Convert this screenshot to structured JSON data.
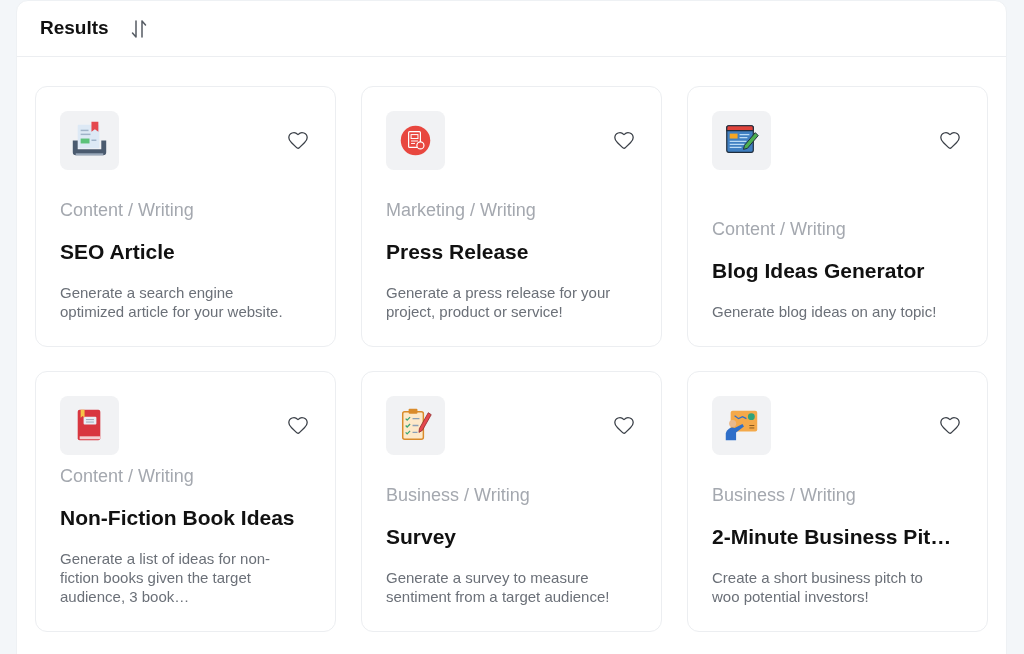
{
  "header": {
    "title": "Results"
  },
  "cards": [
    {
      "category": "Content / Writing",
      "title": "SEO Article",
      "description": "Generate a search engine optimized article for your website.",
      "favorite": false
    },
    {
      "category": "Marketing / Writing",
      "title": "Press Release",
      "description": "Generate a press release for your project, product or service!",
      "favorite": false
    },
    {
      "category": "Content / Writing",
      "title": "Blog Ideas Generator",
      "description": "Generate blog ideas on any topic!",
      "favorite": false
    },
    {
      "category": "Content / Writing",
      "title": "Non-Fiction Book Ideas",
      "description": "Generate a list of ideas for non-fiction books given the target audience, 3 book…",
      "favorite": false
    },
    {
      "category": "Business / Writing",
      "title": "Survey",
      "description": "Generate a survey to measure sentiment from a target audience!",
      "favorite": false
    },
    {
      "category": "Business / Writing",
      "title": "2-Minute Business Pit…",
      "description": "Create a short business pitch to woo potential investors!",
      "favorite": false
    }
  ]
}
